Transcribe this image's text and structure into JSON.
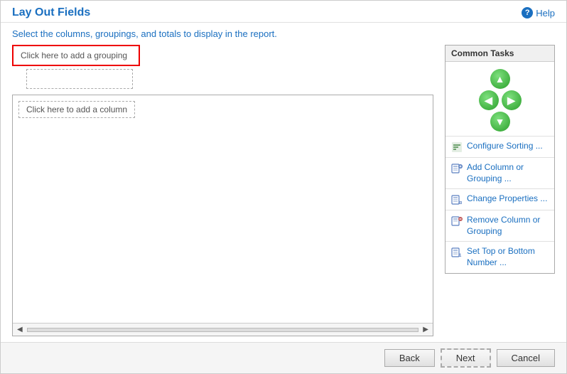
{
  "header": {
    "title": "Lay Out Fields",
    "help_label": "Help"
  },
  "subtitle": {
    "text_before": "Select the columns, groupings, and totals to ",
    "text_highlight": "display",
    "text_after": " in the report."
  },
  "grouping": {
    "add_grouping_label": "Click here to add a grouping"
  },
  "columns": {
    "add_column_label": "Click here to add a column"
  },
  "common_tasks": {
    "title": "Common Tasks",
    "items": [
      {
        "id": "configure-sorting",
        "label": "Configure Sorting ..."
      },
      {
        "id": "add-column-grouping",
        "label": "Add Column or Grouping ..."
      },
      {
        "id": "change-properties",
        "label": "Change Properties ..."
      },
      {
        "id": "remove-column-grouping",
        "label": "Remove Column or Grouping"
      },
      {
        "id": "set-top-bottom",
        "label": "Set Top or Bottom Number ..."
      }
    ]
  },
  "footer": {
    "back_label": "Back",
    "next_label": "Next",
    "cancel_label": "Cancel"
  }
}
